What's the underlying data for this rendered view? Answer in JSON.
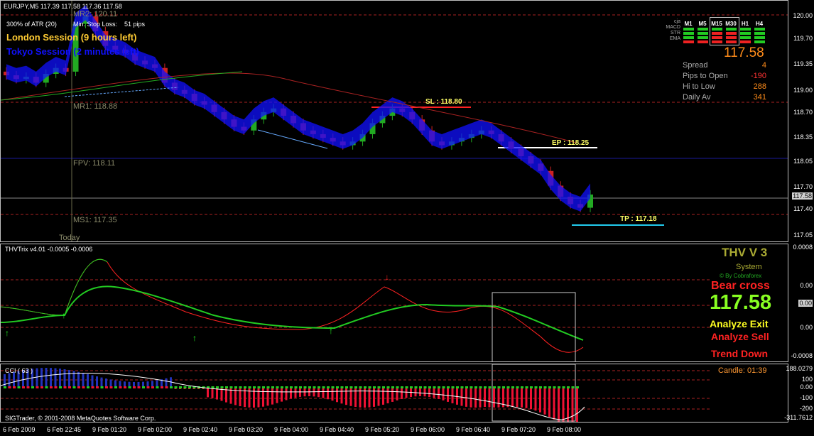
{
  "header": {
    "symbol_line": "EURJPY,M5  117.39 117.58 117.36 117.58",
    "atr_label": "300% of ATR (20)",
    "min_stop_label": "Min. Stop Loss:",
    "min_stop_value": "51 pips"
  },
  "sessions": {
    "london": "London Session (9 hours left)",
    "tokyo": "Tokyo Session (2 minutes left)"
  },
  "levels": {
    "mr2": "MR2: 120.11",
    "mr1": "MR1: 118.88",
    "fpv": "FPV: 118.11",
    "ms1": "MS1: 117.35",
    "today": "Today",
    "sl": "SL : 118.80",
    "ep": "EP : 118.25",
    "tp": "TP : 117.18"
  },
  "main_scale": [
    "120.00",
    "119.70",
    "119.35",
    "119.00",
    "118.70",
    "118.35",
    "118.05",
    "117.70",
    "117.58",
    "117.40",
    "117.05"
  ],
  "trix_scale": [
    "0.0008",
    "0.00",
    "0.00",
    "0.00",
    "-0.0008"
  ],
  "cci_scale": [
    "188.0279",
    "100",
    "0.00",
    "-100",
    "-200",
    "-311.7612"
  ],
  "timeframe_panel": {
    "headers": [
      "M1",
      "M5",
      "M15",
      "M30",
      "H1",
      "H4"
    ],
    "row_labels": [
      "cja",
      "MACD",
      "STR",
      "EMA"
    ],
    "price": "117.58",
    "rows": [
      {
        "label": "Spread",
        "value": "4"
      },
      {
        "label": "Pips to Open",
        "value": "-190"
      },
      {
        "label": "Hi to Low",
        "value": "288"
      },
      {
        "label": "Daily Av",
        "value": "341"
      }
    ]
  },
  "trix": {
    "title": "THVTrix v4.01 -0.0005 -0.0006",
    "brand": "THV V 3",
    "system": "System",
    "credit": "© By Cobraforex",
    "signal": "Bear cross",
    "price": "117.58",
    "analyze_exit": "Analyze Exit",
    "analyze_sell": "Analyze Sell",
    "trend": "Trend Down"
  },
  "cci": {
    "title": "CCI  ( 63 )",
    "candle": "Candle:  01:39"
  },
  "footer": {
    "copyright": "SIGTrader, © 2001-2008 MetaQuotes Software Corp."
  },
  "time_axis": [
    "6 Feb 2009",
    "6 Feb 22:45",
    "9 Feb 01:20",
    "9 Feb 02:00",
    "9 Feb 02:40",
    "9 Feb 03:20",
    "9 Feb 04:00",
    "9 Feb 04:40",
    "9 Feb 05:20",
    "9 Feb 06:00",
    "9 Feb 06:40",
    "9 Feb 07:20",
    "9 Feb 08:00"
  ],
  "colors": {
    "bull": "#22aa22",
    "bear": "#cc2222",
    "cloud": "#1010ff",
    "trix_fast": "#ff2222",
    "trix_slow": "#22cc22"
  },
  "chart_data": {
    "type": "candlestick",
    "price_series": [
      119.2,
      119.15,
      119.18,
      119.1,
      119.22,
      119.3,
      119.25,
      119.9,
      120.0,
      119.8,
      119.6,
      119.55,
      119.5,
      119.4,
      119.35,
      119.3,
      119.1,
      119.0,
      118.95,
      118.85,
      118.8,
      118.7,
      118.6,
      118.5,
      118.45,
      118.6,
      118.7,
      118.75,
      118.65,
      118.55,
      118.45,
      118.4,
      118.35,
      118.3,
      118.25,
      118.3,
      118.4,
      118.55,
      118.65,
      118.75,
      118.7,
      118.6,
      118.45,
      118.3,
      118.25,
      118.3,
      118.35,
      118.4,
      118.45,
      118.4,
      118.3,
      118.2,
      118.1,
      118.0,
      117.9,
      117.7,
      117.55,
      117.45,
      117.4,
      117.58
    ],
    "ylim": [
      117.0,
      120.05
    ]
  }
}
